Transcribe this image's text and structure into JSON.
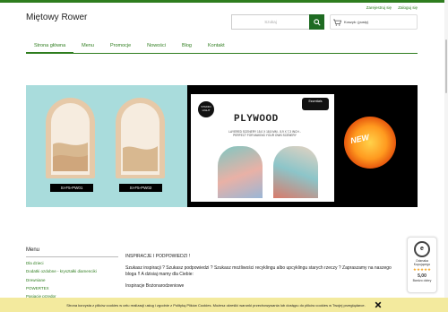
{
  "header": {
    "brand": "Miętowy Rower",
    "top_links": [
      "Zarejestruj się",
      "Zaloguj się"
    ],
    "search_placeholder": "Szukaj",
    "cart_label": "Koszyk: (pusty)"
  },
  "nav": {
    "items": [
      "Strona główna",
      "Menu",
      "Promocje",
      "Nowości",
      "Blog",
      "Kontakt"
    ],
    "active_index": 0
  },
  "banner": {
    "left_captions": [
      "SI-F5-PW01",
      "SI-F5-PW02"
    ],
    "title": "PLYWOOD",
    "spec_line1": "LAYERED SCENERY  15,0 X 18,5 MM - 5,9 X 7,3 INCH -",
    "spec_line2": "PERFECT FOR MAKING YOUR OWN SCENERY",
    "logo_text": "STUDIO LIGHT",
    "essentials_text": "Essentials",
    "new_badge": "NEW"
  },
  "sidebar": {
    "title": "Menu",
    "items": [
      "Dla dzieci",
      "Dodatki ozdobne - kryształki diamenciki",
      "Drewniane",
      "POWERTEX",
      "Pasiacie przedpr"
    ]
  },
  "content": {
    "heading": "INSPIRACJE I PODPOWIEDZI !",
    "paragraph": "Szukasz inspiracji ? Szukasz podpowiedzi ? Szukasz możliwości recyklingu albo upcyklingu starych rzeczy ? Zapraszamy na naszego bloga !! A dzisiaj mamy dla Ciebie:",
    "subheading": "Inspiracje Bożonarodzeniowe"
  },
  "trust_badge": {
    "line1": "Odznaka",
    "line2": "Kupującego",
    "stars": "★★★★★",
    "score": "5,00",
    "rating_word": "Bardzo dobry"
  },
  "cookie_bar": {
    "text": "Strona korzysta z plików cookies w celu realizacji usług i zgodnie z Polityką Plików Cookies. Możesz określić warunki przechowywania lub dostępu do plików cookies w Twojej przeglądarce."
  },
  "colors": {
    "accent": "#2e7d1e",
    "search_button": "#1e6b22",
    "cookie_bg": "#f3ea9e"
  },
  "icons": [
    "search-icon",
    "cart-icon",
    "close-icon",
    "star-icon"
  ]
}
